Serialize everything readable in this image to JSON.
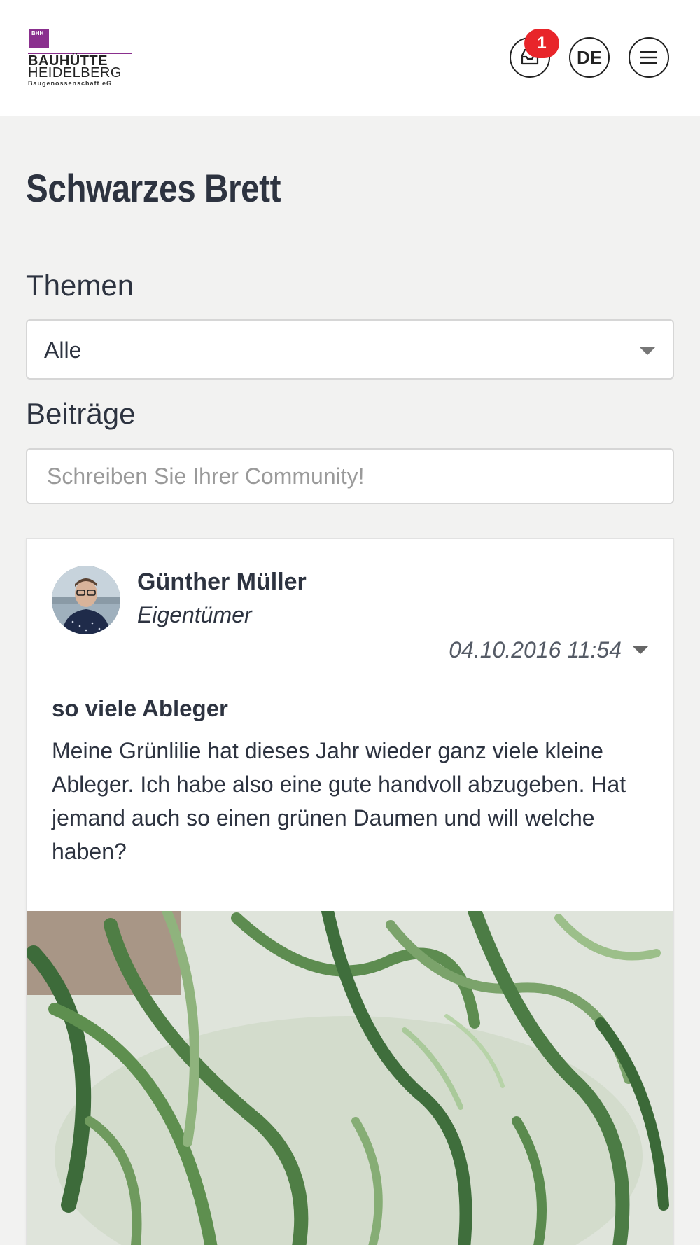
{
  "header": {
    "logo": {
      "mark_text": "BHH",
      "line1": "BAUHÜTTE",
      "line2": "HEIDELBERG",
      "line3": "Baugenossenschaft eG"
    },
    "inbox_badge_count": "1",
    "language": "DE",
    "icons": {
      "inbox": "inbox-icon",
      "menu": "hamburger-menu-icon"
    }
  },
  "page": {
    "title": "Schwarzes Brett"
  },
  "filters": {
    "themes_label": "Themen",
    "themes_selected": "Alle",
    "posts_label": "Beiträge",
    "compose_placeholder": "Schreiben Sie Ihrer Community!"
  },
  "post": {
    "author": "Günther Müller",
    "role": "Eigentümer",
    "date": "04.10.2016 11:54",
    "title": "so viele Ableger",
    "body": "Meine Grünlilie hat dieses Jahr wieder ganz viele kleine Ableger. Ich habe also eine gute handvoll abzugeben. Hat jemand auch so einen grünen Daumen und will welche haben?"
  },
  "colors": {
    "badge": "#e8252a",
    "brand": "#8a2f8e",
    "text": "#2d3340",
    "background": "#f2f2f1"
  }
}
